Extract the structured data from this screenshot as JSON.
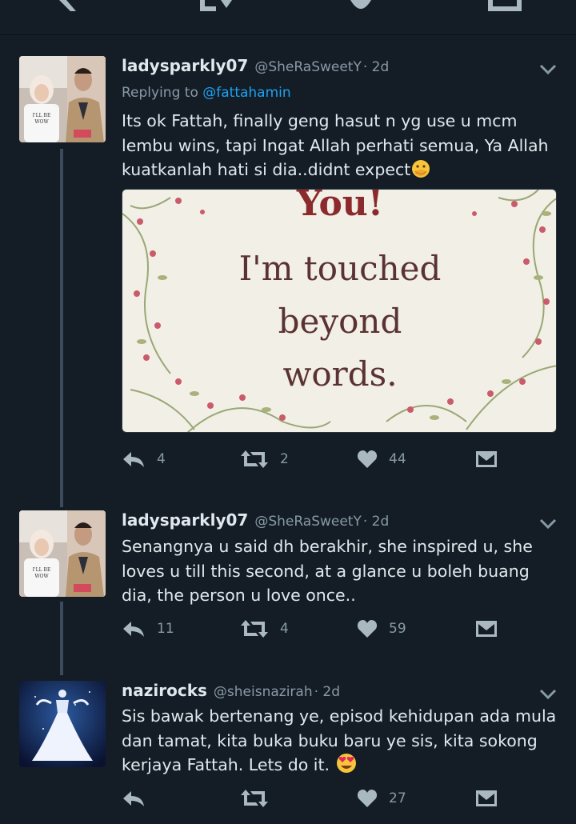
{
  "tweets": [
    {
      "name": "ladysparkly07",
      "handle": "@SheRaSweetY",
      "time": "· 2d",
      "reply_prefix": "Replying to",
      "reply_mention": "@fattahamin",
      "text": "Its ok Fattah, finally geng hasut n yg use u mcm lembu wins, tapi Ingat Allah perhati semua, Ya Allah kuatkanlah hati si dia..didnt expect",
      "emoji": "hand-over-mouth-emoji",
      "media": {
        "line1": "You!",
        "line2": "I'm touched",
        "line3": "beyond",
        "line4": "words."
      },
      "replies": "4",
      "retweets": "2",
      "likes": "44"
    },
    {
      "name": "ladysparkly07",
      "handle": "@SheRaSweetY",
      "time": "· 2d",
      "text": "Senangnya u said dh berakhir, she inspired u, she loves u till this second, at a glance u boleh buang dia, the person u love once..",
      "replies": "11",
      "retweets": "4",
      "likes": "59"
    },
    {
      "name": "nazirocks",
      "handle": "@sheisnazirah",
      "time": "· 2d",
      "text": "Sis bawak bertenang ye, episod kehidupan ada mula dan tamat, kita buka buku baru ye sis, kita sokong kerjaya Fattah. Lets do it.",
      "emoji": "heart-eyes-emoji",
      "replies": "",
      "retweets": "",
      "likes": "27"
    }
  ],
  "colors": {
    "background": "#141d26",
    "text": "#e1e8ed",
    "secondary": "#8899a6",
    "link": "#1da1f2",
    "icon": "#aab8c2",
    "thread_line": "#3b4b5b"
  },
  "icons": [
    "reply-icon",
    "retweet-icon",
    "heart-icon",
    "direct-message-icon",
    "chevron-down-icon"
  ]
}
